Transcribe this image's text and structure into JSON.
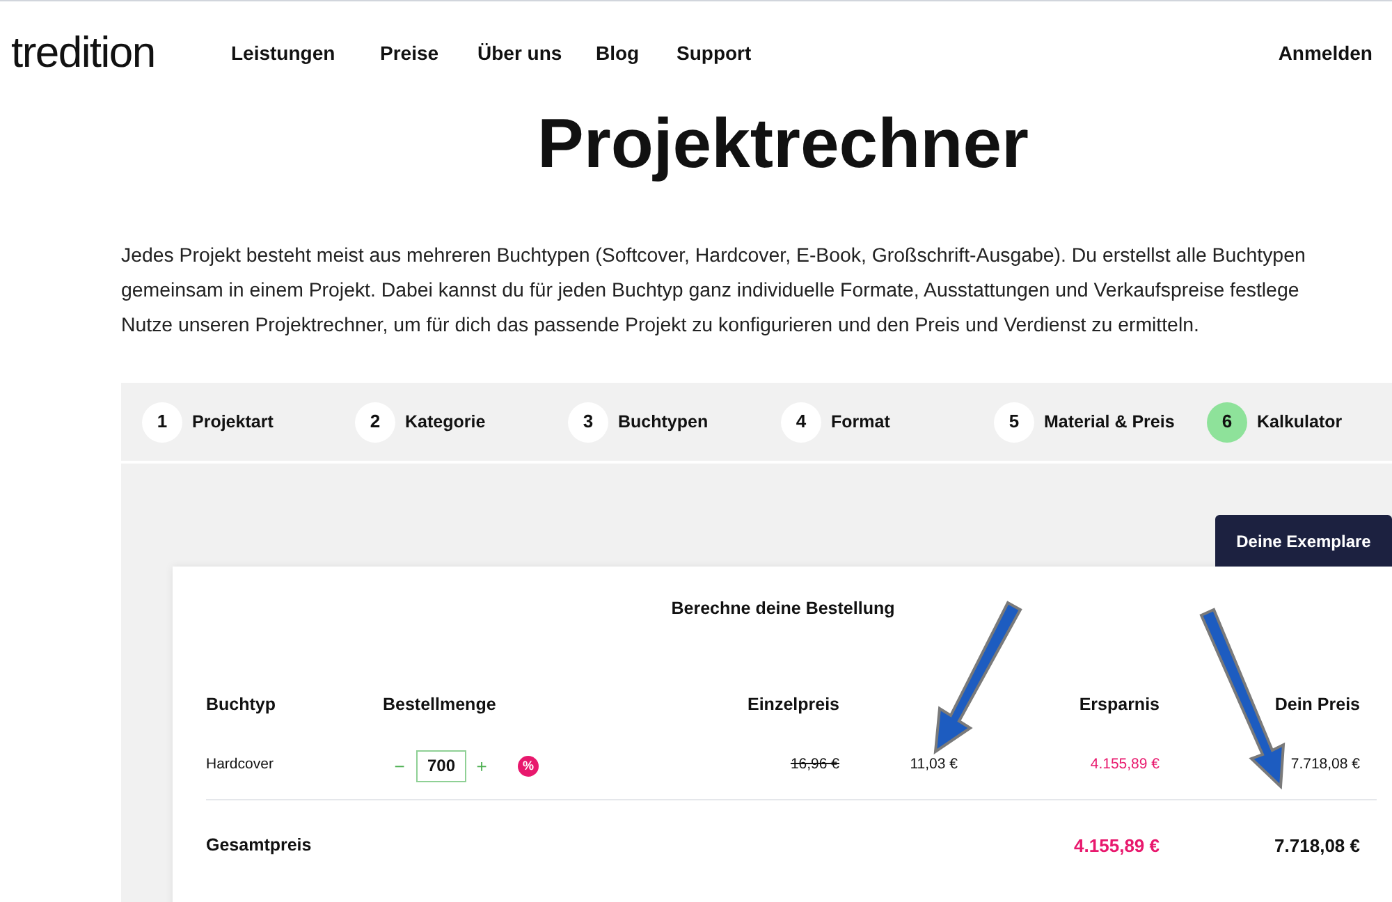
{
  "header": {
    "logo": "tredition",
    "nav": [
      "Leistungen",
      "Preise",
      "Über uns",
      "Blog",
      "Support"
    ],
    "login": "Anmelden"
  },
  "title": "Projektrechner",
  "intro_lines": [
    "Jedes Projekt besteht meist aus mehreren Buchtypen (Softcover, Hardcover, E-Book, Großschrift-Ausgabe). Du erstellst alle Buchtypen",
    "gemeinsam in einem Projekt. Dabei kannst du für jeden Buchtyp ganz individuelle Formate, Ausstattungen und Verkaufspreise festlege",
    "Nutze unseren Projektrechner, um für dich das passende Projekt zu konfigurieren und den Preis und Verdienst zu ermitteln."
  ],
  "steps": [
    {
      "number": "1",
      "label": "Projektart",
      "selected": false
    },
    {
      "number": "2",
      "label": "Kategorie",
      "selected": false
    },
    {
      "number": "3",
      "label": "Buchtypen",
      "selected": false
    },
    {
      "number": "4",
      "label": "Format",
      "selected": false
    },
    {
      "number": "5",
      "label": "Material & Preis",
      "selected": false
    },
    {
      "number": "6",
      "label": "Kalkulator",
      "selected": true
    }
  ],
  "copies_button": "Deine Exemplare",
  "calculator": {
    "title": "Berechne deine Bestellung",
    "columns": [
      "Buchtyp",
      "Bestellmenge",
      "Einzelpreis",
      "Ersparnis",
      "Dein Preis"
    ],
    "rows": [
      {
        "book_type": "Hardcover",
        "minus": "−",
        "quantity": "700",
        "plus": "+",
        "discount_badge": "%",
        "list_price": "16,96 €",
        "unit_price": "11,03 €",
        "savings": "4.155,89 €",
        "your_price": "7.718,08 €"
      }
    ],
    "total": {
      "label": "Gesamtpreis",
      "savings": "4.155,89 €",
      "your_price": "7.718,08 €"
    }
  }
}
